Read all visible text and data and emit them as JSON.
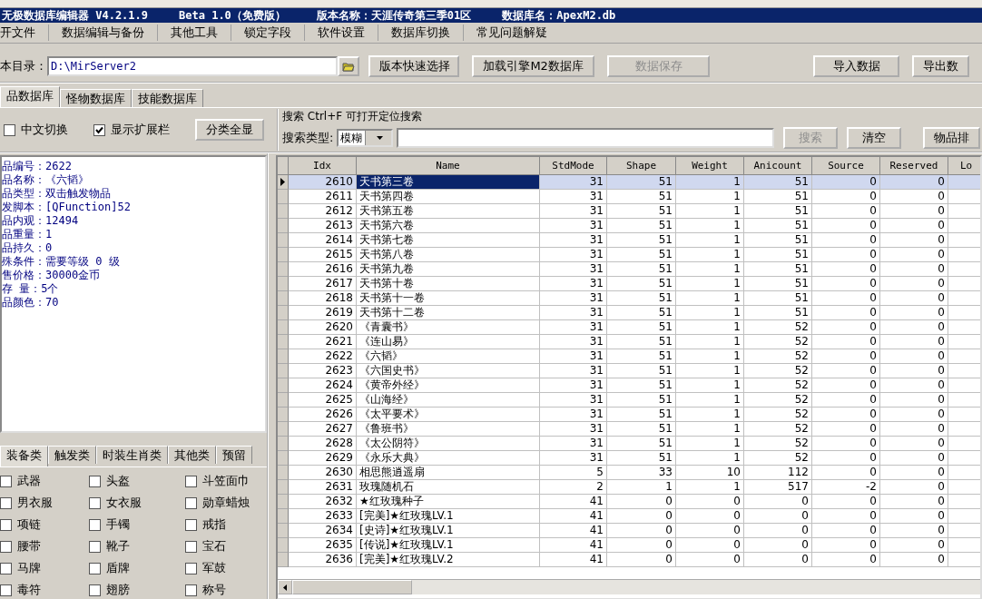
{
  "window": {
    "title_parts": [
      "无极数据库编辑器 V4.2.1.9",
      "Beta 1.0（免费版）",
      "版本名称：天涯传奇第三季01区",
      "数据库名：ApexM2.db"
    ]
  },
  "menu": [
    "开文件",
    "数据编辑与备份",
    "其他工具",
    "锁定字段",
    "软件设置",
    "数据库切换",
    "常见问题解疑"
  ],
  "toolbar": {
    "path_label": "本目录：",
    "path_value": "D:\\MirServer2",
    "buttons": [
      {
        "label": "版本快速选择",
        "disabled": false
      },
      {
        "label": "加载引擎M2数据库",
        "disabled": false
      },
      {
        "label": "数据保存",
        "disabled": true
      },
      {
        "label": "导入数据",
        "disabled": false
      },
      {
        "label": "导出数",
        "disabled": false
      }
    ]
  },
  "tabs": [
    {
      "label": "品数据库",
      "selected": true
    },
    {
      "label": "怪物数据库",
      "selected": false
    },
    {
      "label": "技能数据库",
      "selected": false
    }
  ],
  "options": {
    "checks": [
      {
        "label": "中文切换",
        "checked": false
      },
      {
        "label": "显示扩展栏",
        "checked": true
      }
    ],
    "button": "分类全显"
  },
  "search": {
    "title": "搜索  Ctrl+F 可打开定位搜索",
    "type_label": "搜索类型:",
    "type_value": "模糊",
    "buttons": [
      {
        "label": "搜索",
        "disabled": true
      },
      {
        "label": "清空",
        "disabled": false
      }
    ],
    "sort_button": "物品排"
  },
  "info": [
    "品编号：2622",
    "品名称：《六韬》",
    "品类型：双击触发物品",
    "发脚本：[QFunction]52",
    "品内观：12494",
    "品重量：1",
    "品持久：0",
    "殊条件：需要等级 0 级",
    "售价格：30000金币",
    "存 量：5个",
    "品颜色：70"
  ],
  "category_tabs": [
    {
      "label": "装备类",
      "selected": true
    },
    {
      "label": "触发类",
      "selected": false
    },
    {
      "label": "时装生肖类",
      "selected": false
    },
    {
      "label": "其他类",
      "selected": false
    },
    {
      "label": "预留",
      "selected": false
    }
  ],
  "categories": [
    {
      "label": "武器",
      "checked": false
    },
    {
      "label": "头盔",
      "checked": false
    },
    {
      "label": "斗笠面巾",
      "checked": false
    },
    {
      "label": "男衣服",
      "checked": false
    },
    {
      "label": "女衣服",
      "checked": false
    },
    {
      "label": "勋章蜡烛",
      "checked": false
    },
    {
      "label": "项链",
      "checked": false
    },
    {
      "label": "手镯",
      "checked": false
    },
    {
      "label": "戒指",
      "checked": false
    },
    {
      "label": "腰带",
      "checked": false
    },
    {
      "label": "靴子",
      "checked": false
    },
    {
      "label": "宝石",
      "checked": false
    },
    {
      "label": "马牌",
      "checked": false
    },
    {
      "label": "盾牌",
      "checked": false
    },
    {
      "label": "军鼓",
      "checked": false
    },
    {
      "label": "毒符",
      "checked": false
    },
    {
      "label": "翅膀",
      "checked": false
    },
    {
      "label": "称号",
      "checked": false
    }
  ],
  "table": {
    "columns": [
      "Idx",
      "Name",
      "StdMode",
      "Shape",
      "Weight",
      "Anicount",
      "Source",
      "Reserved",
      "Lo"
    ],
    "rows": [
      {
        "cells": [
          "2610",
          "天书第三卷",
          "31",
          "51",
          "1",
          "51",
          "0",
          "0"
        ],
        "selected": true
      },
      {
        "cells": [
          "2611",
          "天书第四卷",
          "31",
          "51",
          "1",
          "51",
          "0",
          "0"
        ],
        "selected": false
      },
      {
        "cells": [
          "2612",
          "天书第五卷",
          "31",
          "51",
          "1",
          "51",
          "0",
          "0"
        ],
        "selected": false
      },
      {
        "cells": [
          "2613",
          "天书第六卷",
          "31",
          "51",
          "1",
          "51",
          "0",
          "0"
        ],
        "selected": false
      },
      {
        "cells": [
          "2614",
          "天书第七卷",
          "31",
          "51",
          "1",
          "51",
          "0",
          "0"
        ],
        "selected": false
      },
      {
        "cells": [
          "2615",
          "天书第八卷",
          "31",
          "51",
          "1",
          "51",
          "0",
          "0"
        ],
        "selected": false
      },
      {
        "cells": [
          "2616",
          "天书第九卷",
          "31",
          "51",
          "1",
          "51",
          "0",
          "0"
        ],
        "selected": false
      },
      {
        "cells": [
          "2617",
          "天书第十卷",
          "31",
          "51",
          "1",
          "51",
          "0",
          "0"
        ],
        "selected": false
      },
      {
        "cells": [
          "2618",
          "天书第十一卷",
          "31",
          "51",
          "1",
          "51",
          "0",
          "0"
        ],
        "selected": false
      },
      {
        "cells": [
          "2619",
          "天书第十二卷",
          "31",
          "51",
          "1",
          "51",
          "0",
          "0"
        ],
        "selected": false
      },
      {
        "cells": [
          "2620",
          "《青囊书》",
          "31",
          "51",
          "1",
          "52",
          "0",
          "0"
        ],
        "selected": false
      },
      {
        "cells": [
          "2621",
          "《连山易》",
          "31",
          "51",
          "1",
          "52",
          "0",
          "0"
        ],
        "selected": false
      },
      {
        "cells": [
          "2622",
          "《六韬》",
          "31",
          "51",
          "1",
          "52",
          "0",
          "0"
        ],
        "selected": false
      },
      {
        "cells": [
          "2623",
          "《六国史书》",
          "31",
          "51",
          "1",
          "52",
          "0",
          "0"
        ],
        "selected": false
      },
      {
        "cells": [
          "2624",
          "《黄帝外经》",
          "31",
          "51",
          "1",
          "52",
          "0",
          "0"
        ],
        "selected": false
      },
      {
        "cells": [
          "2625",
          "《山海经》",
          "31",
          "51",
          "1",
          "52",
          "0",
          "0"
        ],
        "selected": false
      },
      {
        "cells": [
          "2626",
          "《太平要术》",
          "31",
          "51",
          "1",
          "52",
          "0",
          "0"
        ],
        "selected": false
      },
      {
        "cells": [
          "2627",
          "《鲁班书》",
          "31",
          "51",
          "1",
          "52",
          "0",
          "0"
        ],
        "selected": false
      },
      {
        "cells": [
          "2628",
          "《太公阴符》",
          "31",
          "51",
          "1",
          "52",
          "0",
          "0"
        ],
        "selected": false
      },
      {
        "cells": [
          "2629",
          "《永乐大典》",
          "31",
          "51",
          "1",
          "52",
          "0",
          "0"
        ],
        "selected": false
      },
      {
        "cells": [
          "2630",
          "相思熊逍遥扇",
          "5",
          "33",
          "10",
          "112",
          "0",
          "0"
        ],
        "selected": false
      },
      {
        "cells": [
          "2631",
          "玫瑰随机石",
          "2",
          "1",
          "1",
          "517",
          "-2",
          "0"
        ],
        "selected": false
      },
      {
        "cells": [
          "2632",
          "★红玫瑰种子",
          "41",
          "0",
          "0",
          "0",
          "0",
          "0"
        ],
        "selected": false
      },
      {
        "cells": [
          "2633",
          "[完美]★红玫瑰LV.1",
          "41",
          "0",
          "0",
          "0",
          "0",
          "0"
        ],
        "selected": false
      },
      {
        "cells": [
          "2634",
          "[史诗]★红玫瑰LV.1",
          "41",
          "0",
          "0",
          "0",
          "0",
          "0"
        ],
        "selected": false
      },
      {
        "cells": [
          "2635",
          "[传说]★红玫瑰LV.1",
          "41",
          "0",
          "0",
          "0",
          "0",
          "0"
        ],
        "selected": false
      },
      {
        "cells": [
          "2636",
          "[完美]★红玫瑰LV.2",
          "41",
          "0",
          "0",
          "0",
          "0",
          "0"
        ],
        "selected": false
      }
    ]
  }
}
